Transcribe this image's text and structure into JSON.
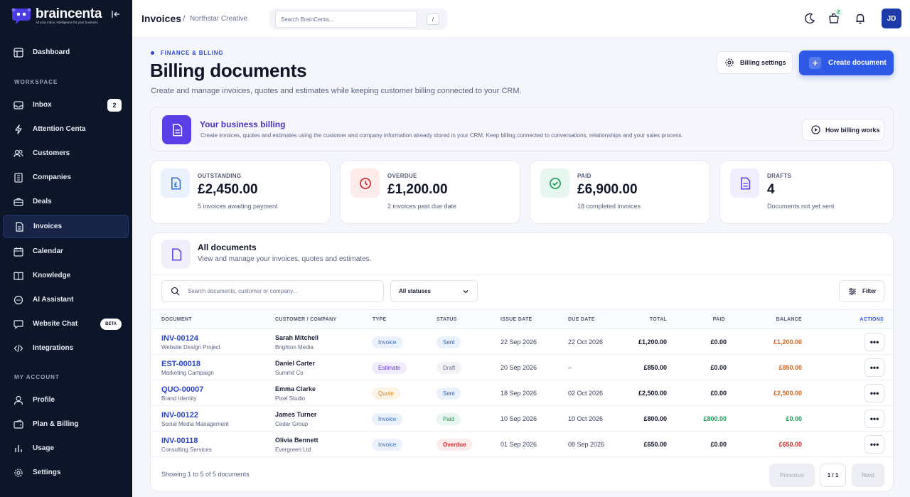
{
  "brand": {
    "name": "braincenta",
    "tagline": "All your inbox, intelligence for your business"
  },
  "sidebar": {
    "items": [
      {
        "label": "Dashboard",
        "icon": "dashboard-icon"
      },
      {
        "label": "Inbox",
        "badge": "2",
        "icon": "inbox-icon"
      },
      {
        "label": "Attention Centa",
        "icon": "bolt-icon"
      },
      {
        "label": "Customers",
        "icon": "users-icon"
      },
      {
        "label": "Companies",
        "icon": "building-icon"
      },
      {
        "label": "Deals",
        "icon": "briefcase-icon"
      },
      {
        "label": "Invoices",
        "icon": "document-icon",
        "active": true
      },
      {
        "label": "Calendar",
        "icon": "calendar-icon"
      },
      {
        "label": "Knowledge",
        "icon": "book-icon"
      },
      {
        "label": "AI Assistant",
        "icon": "chat-ai-icon"
      },
      {
        "label": "Website Chat",
        "badge": "BETA",
        "icon": "chat-icon"
      },
      {
        "label": "Integrations",
        "icon": "code-icon"
      },
      {
        "label": "Profile",
        "icon": "user-icon"
      },
      {
        "label": "Plan & Billing",
        "icon": "wallet-icon"
      },
      {
        "label": "Usage",
        "icon": "usage-icon"
      },
      {
        "label": "Settings",
        "icon": "gear-icon"
      }
    ],
    "section_workspace": "WORKSPACE",
    "section_account": "MY ACCOUNT"
  },
  "topbar": {
    "title": "Invoices",
    "separator": "/",
    "subtitle": "Northstar Creative",
    "search_placeholder": "Search BrainCenta...",
    "shortcut": "/",
    "cart_badge": "2",
    "avatar": "JD"
  },
  "header": {
    "eyebrow": "FINANCE & BLLING",
    "title": "Billing documents",
    "subtitle": "Create and manage invoices, quotes and estimates while keeping customer billing connected to your CRM.",
    "settings_label": "Billing settings",
    "create_label": "Create document"
  },
  "banner": {
    "title": "Your business billing",
    "subtitle": "Create invoices, quotes and estimates using the customer and company information already stored in your CRM. Keep billing connected to conversations, relationships and your sales process.",
    "button": "How billing works"
  },
  "stats": [
    {
      "label": "OUTSTANDING",
      "value": "£2,450.00",
      "note": "5 invoices awaiting payment"
    },
    {
      "label": "OVERDUE",
      "value": "£1,200.00",
      "note": "2 invoices past due date"
    },
    {
      "label": "PAID",
      "value": "£6,900.00",
      "note": "18 completed invoices"
    },
    {
      "label": "DRAFTS",
      "value": "4",
      "note": "Documents not yet sent"
    }
  ],
  "documents": {
    "title": "All documents",
    "subtitle": "View and manage your invoices, quotes and estimates.",
    "search_placeholder": "Search documents, customer or company...",
    "status_filter": "All statuses",
    "filter_label": "Filter",
    "columns": [
      "DOCUMENT",
      "CUSTOMER / COMPANY",
      "TYPE",
      "STATUS",
      "ISSUE DATE",
      "DUE DATE",
      "TOTAL",
      "PAID",
      "BALANCE",
      "ACTIONS"
    ],
    "rows": [
      {
        "number": "INV-00124",
        "desc": "Website Design Project",
        "customer": "Sarah Mitchell",
        "company": "Brighton Media",
        "type": "Invoice",
        "status": "Sent",
        "issue": "22 Sep 2026",
        "due": "22 Oct 2026",
        "total": "£1,200.00",
        "paid": "£0.00",
        "balance": "£1,200.00",
        "actions": "•••"
      },
      {
        "number": "EST-00018",
        "desc": "Marketing Campaign",
        "customer": "Daniel Carter",
        "company": "Summit Co",
        "type": "Estimate",
        "status": "Draft",
        "issue": "20 Sep 2026",
        "due": "–",
        "total": "£850.00",
        "paid": "£0.00",
        "balance": "£850.00",
        "actions": "•••"
      },
      {
        "number": "QUO-00007",
        "desc": "Brand Identity",
        "customer": "Emma Clarke",
        "company": "Pixel Studio",
        "type": "Quote",
        "status": "Sent",
        "issue": "18 Sep 2026",
        "due": "02 Oct 2026",
        "total": "£2,500.00",
        "paid": "£0.00",
        "balance": "£2,500.00",
        "actions": "•••"
      },
      {
        "number": "INV-00122",
        "desc": "Social Media Management",
        "customer": "James Turner",
        "company": "Cedar Group",
        "type": "Invoice",
        "status": "Paid",
        "issue": "10 Sep 2026",
        "due": "10 Oct 2026",
        "total": "£800.00",
        "paid": "£800.00",
        "balance": "£0.00",
        "actions": "•••"
      },
      {
        "number": "INV-00118",
        "desc": "Consulting Services",
        "customer": "Olivia Bennett",
        "company": "Evergreen Ltd",
        "type": "Invoice",
        "status": "Overdue",
        "issue": "01 Sep 2026",
        "due": "08 Sep 2026",
        "total": "£650.00",
        "paid": "£0.00",
        "balance": "£650.00",
        "actions": "•••"
      }
    ],
    "footer": "Showing 1 to 5 of 5 documents",
    "prev": "Previous",
    "page": "1 / 1",
    "next": "Next"
  },
  "colors": {
    "accent": "#2f5ae8",
    "sidebar_bg": "#0d1529",
    "sent": "#2a6fd6",
    "paid": "#1b9a55",
    "overdue": "#d12c2c",
    "balance_orange": "#d9651e",
    "balance_red": "#d12c2c",
    "balance_green": "#1b9a55"
  }
}
